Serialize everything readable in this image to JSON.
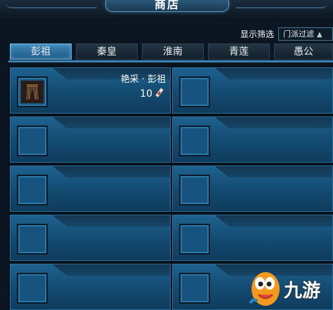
{
  "window": {
    "title": "商店"
  },
  "filter": {
    "label": "显示筛选",
    "selected": "门派过滤"
  },
  "tabs": [
    {
      "label": "彭祖",
      "active": true
    },
    {
      "label": "秦皇",
      "active": false
    },
    {
      "label": "淮南",
      "active": false
    },
    {
      "label": "青莲",
      "active": false
    },
    {
      "label": "愚公",
      "active": false
    }
  ],
  "items": [
    {
      "name": "艳采 · 彭祖",
      "price": "10",
      "icon": "armor-pants-icon",
      "currency_icon": "currency-token-icon"
    }
  ],
  "empty_slots": 9,
  "watermark": {
    "text": "九游",
    "icon": "mascot-logo-icon"
  },
  "colors": {
    "active_tab": "#2f74a6",
    "card_bg": "#16537e",
    "background": "#0b1622"
  }
}
